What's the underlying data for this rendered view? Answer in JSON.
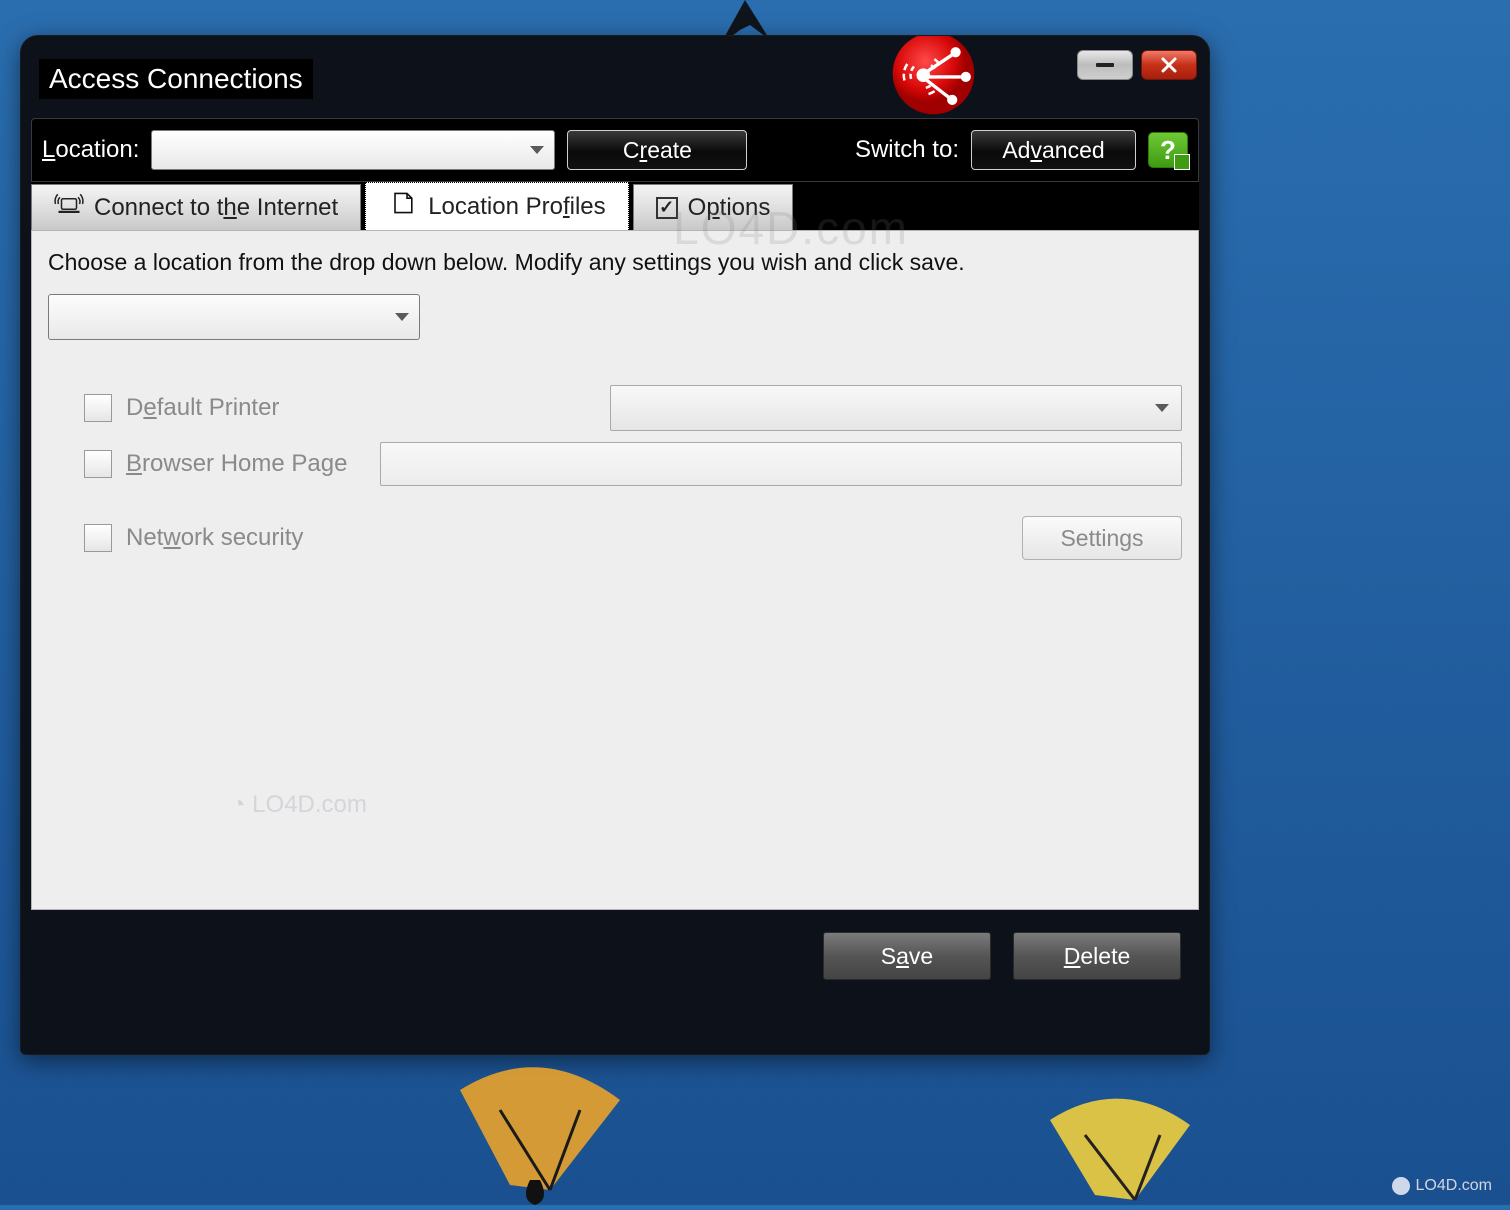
{
  "app": {
    "title": "Access Connections"
  },
  "titlebar": {
    "minimize": "Minimize",
    "close": "Close"
  },
  "toolbar": {
    "location_label_pre": "L",
    "location_label_post": "ocation:",
    "location_value": "",
    "create_pre": "C",
    "create_u": "r",
    "create_post": "eate",
    "switch_label": "Switch to:",
    "advanced_pre": "Ad",
    "advanced_u": "v",
    "advanced_post": "anced",
    "help": "?"
  },
  "tabs": {
    "t1_pre": "Connect to t",
    "t1_u": "h",
    "t1_post": "e Internet",
    "t2_pre": "Location Pro",
    "t2_u": "f",
    "t2_post": "iles",
    "t3_pre": "O",
    "t3_u": "p",
    "t3_post": "tions"
  },
  "panel": {
    "instruction": "Choose a location from the drop down below. Modify any settings you wish and click save.",
    "profile_value": "",
    "default_printer_pre": "D",
    "default_printer_u": "e",
    "default_printer_post": "fault Printer",
    "printer_value": "",
    "browser_pre": "",
    "browser_u": "B",
    "browser_post": "rowser Home Page",
    "homepage_value": "",
    "netsec_pre": "Net",
    "netsec_u": "w",
    "netsec_post": "ork security",
    "settings_btn": "Settings"
  },
  "footer": {
    "save_pre": "S",
    "save_u": "a",
    "save_post": "ve",
    "delete_pre": "",
    "delete_u": "D",
    "delete_post": "elete"
  },
  "watermark": "LO4D.com",
  "attribution": "LO4D.com"
}
